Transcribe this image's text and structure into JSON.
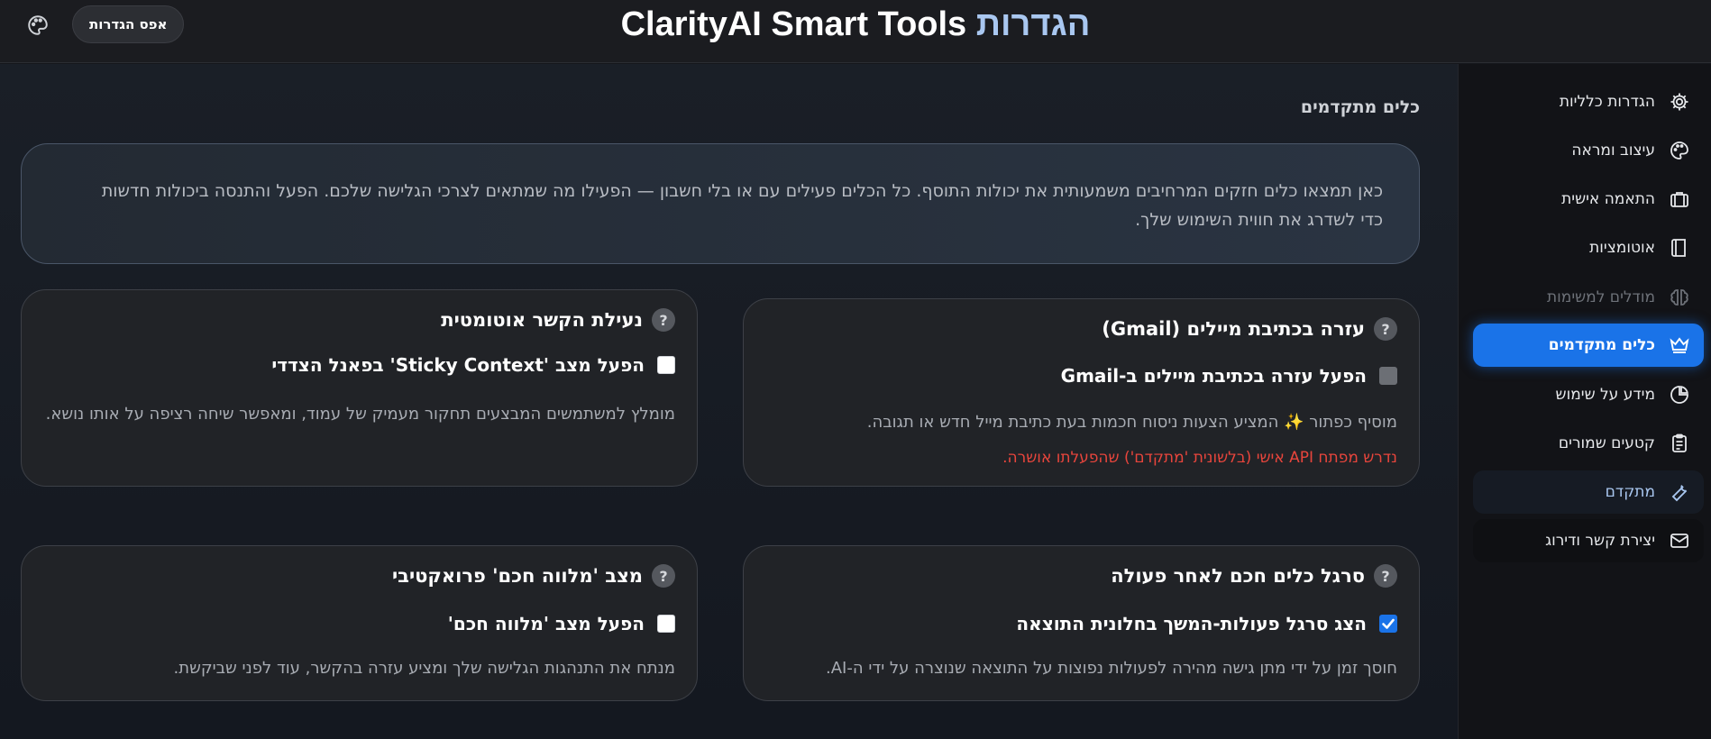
{
  "header": {
    "title_main": "ClarityAI Smart Tools",
    "title_accent": "הגדרות",
    "reset_label": "אפס הגדרות",
    "palette_icon": "palette-icon"
  },
  "sidebar": {
    "items": [
      {
        "label": "הגדרות כלליות",
        "icon": "gear-icon",
        "state": "normal"
      },
      {
        "label": "עיצוב ומראה",
        "icon": "palette-icon",
        "state": "normal"
      },
      {
        "label": "התאמה אישית",
        "icon": "briefcase-icon",
        "state": "normal"
      },
      {
        "label": "אוטומציות",
        "icon": "book-icon",
        "state": "normal"
      },
      {
        "label": "מודלים למשימות",
        "icon": "brain-icon",
        "state": "disabled"
      },
      {
        "label": "כלים מתקדמים",
        "icon": "crown-icon",
        "state": "active"
      },
      {
        "label": "מידע על שימוש",
        "icon": "pie-chart-icon",
        "state": "normal"
      },
      {
        "label": "קטעים שמורים",
        "icon": "clipboard-icon",
        "state": "normal"
      },
      {
        "label": "מתקדם",
        "icon": "wrench-icon",
        "state": "highlight"
      },
      {
        "label": "יצירת קשר ודירוג",
        "icon": "mail-icon",
        "state": "highlight-dark"
      }
    ]
  },
  "main": {
    "section_title": "כלים מתקדמים",
    "intro": "כאן תמצאו כלים חזקים המרחיבים משמעותית את יכולות התוסף. כל הכלים פעילים עם או בלי חשבון — הפעילו מה שמתאים לצרכי הגלישה שלכם. הפעל והתנסה ביכולות חדשות כדי לשדרג את חווית השימוש שלך.",
    "cards": [
      {
        "title": "עזרה בכתיבת מיילים (Gmail)",
        "checkbox_label": "הפעל עזרה בכתיבת מיילים ב-Gmail",
        "checkbox_state": "disabled",
        "description": "מוסיף כפתור ✨ המציע הצעות ניסוח חכמות בעת כתיבת מייל חדש או תגובה.",
        "warning": "נדרש מפתח API אישי (בלשונית 'מתקדם') שהפעלתו אושרה."
      },
      {
        "title": "נעילת הקשר אוטומטית",
        "checkbox_label": "הפעל מצב 'Sticky Context' בפאנל הצדדי",
        "checkbox_state": "unchecked",
        "description": "מומלץ למשתמשים המבצעים תחקור מעמיק של עמוד, ומאפשר שיחה רציפה על אותו נושא."
      },
      {
        "title": "סרגל כלים חכם לאחר פעולה",
        "checkbox_label": "הצג סרגל פעולות-המשך בחלונית התוצאה",
        "checkbox_state": "checked",
        "description": "חוסך זמן על ידי מתן גישה מהירה לפעולות נפוצות על התוצאה שנוצרה על ידי ה-AI."
      },
      {
        "title": "מצב 'מלווה חכם' פרואקטיבי",
        "checkbox_label": "הפעל מצב 'מלווה חכם'",
        "checkbox_state": "unchecked",
        "description": "מנתח את התנהגות הגלישה שלך ומציע עזרה בהקשר, עוד לפני שביקשת."
      }
    ],
    "help_glyph": "?"
  },
  "colors": {
    "accent": "#1a73e8",
    "title_accent": "#a9c7f0",
    "warning": "#e8453c"
  }
}
